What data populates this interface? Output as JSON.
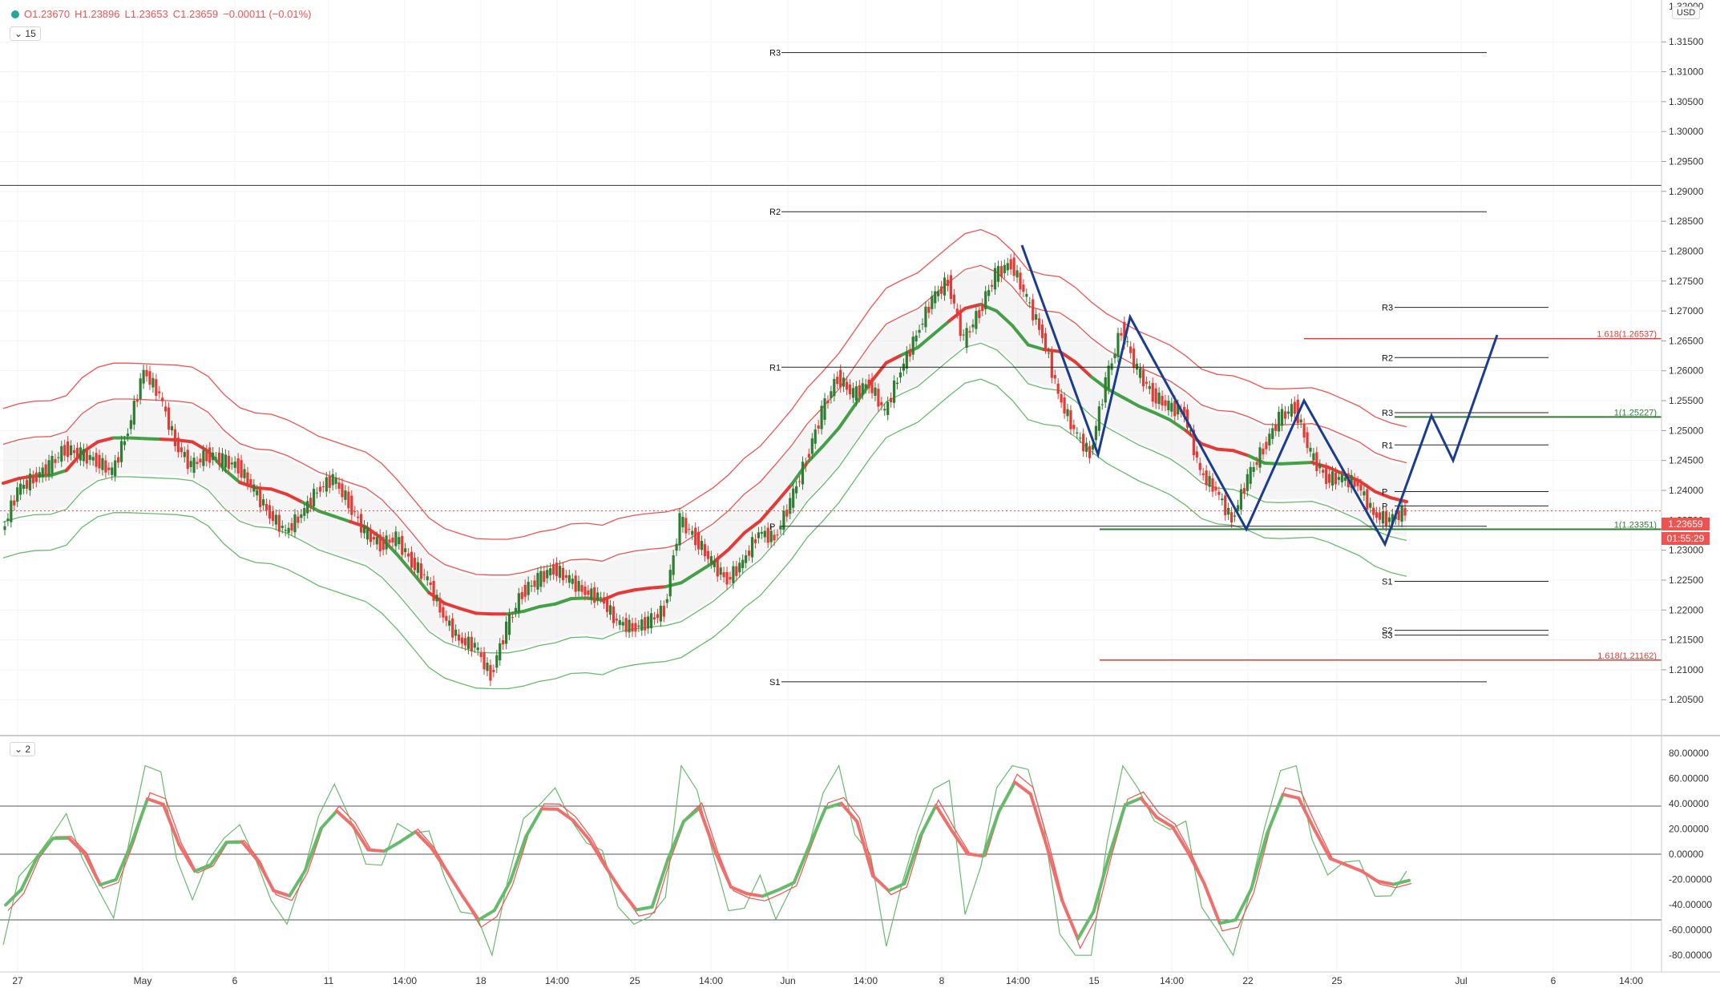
{
  "legend": {
    "open": "O1.23670",
    "high": "H1.23896",
    "low": "L1.23653",
    "close": "C1.23659",
    "change": "−0.00011 (−0.01%)",
    "interval": "15",
    "sub_index": "2",
    "currency": "USD"
  },
  "price_label": {
    "value": "1.23659",
    "countdown": "01:55:29"
  },
  "colors": {
    "up": "#2e7d32",
    "down": "#e53935",
    "pattern": "#1a3d8f",
    "grid": "#eeeeee"
  },
  "chart_data": [
    {
      "type": "candlestick",
      "ylim": [
        1.199,
        1.322
      ],
      "y_ticks": [
        "1.20500",
        "1.21000",
        "1.21500",
        "1.22000",
        "1.22500",
        "1.23000",
        "1.23500",
        "1.24000",
        "1.24500",
        "1.25000",
        "1.25500",
        "1.26000",
        "1.26500",
        "1.27000",
        "1.27500",
        "1.28000",
        "1.28500",
        "1.29000",
        "1.29500",
        "1.30000",
        "1.30500",
        "1.31000",
        "1.31500"
      ],
      "y_top_partial": "1.32000",
      "x_ticks": [
        "27",
        "May",
        "6",
        "11",
        "14:00",
        "18",
        "14:00",
        "25",
        "14:00",
        "Jun",
        "14:00",
        "8",
        "14:00",
        "15",
        "14:00",
        "22",
        "25",
        "Jul",
        "6",
        "14:00"
      ],
      "close_trace": [
        1.233,
        1.24,
        1.242,
        1.244,
        1.247,
        1.246,
        1.245,
        1.243,
        1.25,
        1.26,
        1.256,
        1.248,
        1.244,
        1.246,
        1.245,
        1.244,
        1.24,
        1.236,
        1.233,
        1.236,
        1.24,
        1.242,
        1.238,
        1.233,
        1.231,
        1.232,
        1.228,
        1.225,
        1.219,
        1.215,
        1.214,
        1.209,
        1.217,
        1.223,
        1.225,
        1.227,
        1.225,
        1.223,
        1.222,
        1.218,
        1.217,
        1.218,
        1.22,
        1.235,
        1.232,
        1.228,
        1.225,
        1.228,
        1.233,
        1.232,
        1.238,
        1.245,
        1.253,
        1.259,
        1.256,
        1.258,
        1.253,
        1.26,
        1.266,
        1.272,
        1.275,
        1.265,
        1.27,
        1.276,
        1.278,
        1.272,
        1.266,
        1.256,
        1.25,
        1.246,
        1.258,
        1.267,
        1.26,
        1.256,
        1.254,
        1.253,
        1.243,
        1.24,
        1.235,
        1.242,
        1.247,
        1.252,
        1.254,
        1.246,
        1.242,
        1.242,
        1.241,
        1.236,
        1.235,
        1.2366
      ],
      "bands": {
        "ma_line_red_green": true,
        "upper_outer": "red",
        "upper_inner": "red",
        "lower_inner": "green",
        "lower_outer": "green"
      },
      "pivot_levels": [
        {
          "label": "R3",
          "value": 1.3132
        },
        {
          "label": "R2",
          "value": 1.2866
        },
        {
          "label": "R1",
          "value": 1.2606
        },
        {
          "label": "P",
          "value": 1.234
        },
        {
          "label": "S1",
          "value": 1.208
        }
      ],
      "pivot_levels_right": [
        {
          "label": "R3",
          "value": 1.2706
        },
        {
          "label": "R2",
          "value": 1.2622
        },
        {
          "label": "R3",
          "value": 1.253
        },
        {
          "label": "R1",
          "value": 1.2476
        },
        {
          "label": "P",
          "value": 1.2398
        },
        {
          "label": "P",
          "value": 1.2374
        },
        {
          "label": "S1",
          "value": 1.2248
        },
        {
          "label": "S2",
          "value": 1.2166
        },
        {
          "label": "S3",
          "value": 1.2158
        }
      ],
      "fib_levels": [
        {
          "label": "1.618(1.26537)",
          "value": 1.26537,
          "color": "red"
        },
        {
          "label": "1(1.25227)",
          "value": 1.25227,
          "color": "green"
        },
        {
          "label": "1(1.23351)",
          "value": 1.23351,
          "color": "green"
        },
        {
          "label": "1.618(1.21162)",
          "value": 1.21162,
          "color": "red"
        }
      ],
      "horizontal_line": 1.291,
      "last_price": 1.23659
    },
    {
      "type": "line",
      "ylim": [
        -90,
        90
      ],
      "y_ticks": [
        "80.00000",
        "60.00000",
        "40.00000",
        "20.00000",
        "0.00000",
        "-20.00000",
        "-40.00000",
        "-60.00000",
        "-80.00000"
      ],
      "hlines": [
        38,
        0,
        -52
      ]
    }
  ]
}
